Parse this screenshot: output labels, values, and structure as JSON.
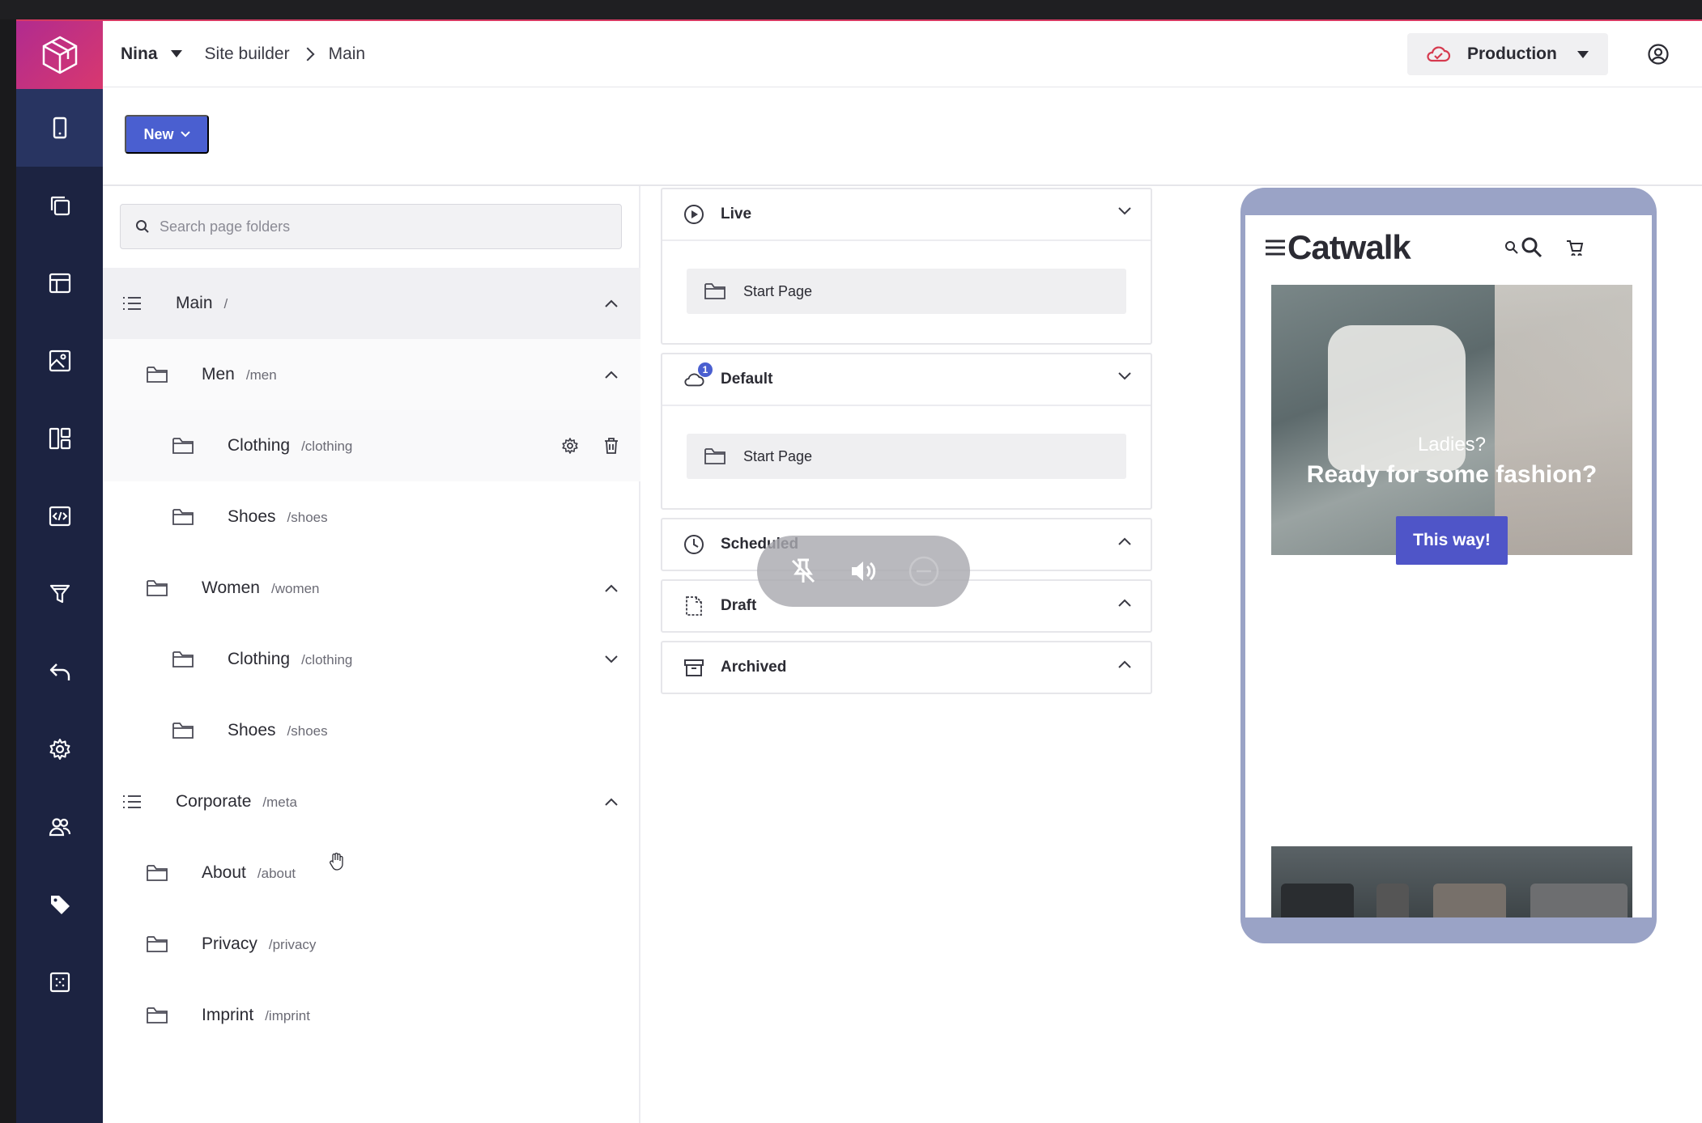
{
  "header": {
    "user": "Nina",
    "breadcrumb": [
      "Site builder",
      "Main"
    ],
    "environment": "Production"
  },
  "toolbar": {
    "new_label": "New"
  },
  "search": {
    "placeholder": "Search page folders"
  },
  "tree": [
    {
      "name": "Main",
      "path": "/"
    },
    {
      "name": "Men",
      "path": "/men"
    },
    {
      "name": "Clothing",
      "path": "/clothing"
    },
    {
      "name": "Shoes",
      "path": "/shoes"
    },
    {
      "name": "Women",
      "path": "/women"
    },
    {
      "name": "Clothing",
      "path": "/clothing"
    },
    {
      "name": "Shoes",
      "path": "/shoes"
    },
    {
      "name": "Corporate",
      "path": "/meta"
    },
    {
      "name": "About",
      "path": "/about"
    },
    {
      "name": "Privacy",
      "path": "/privacy"
    },
    {
      "name": "Imprint",
      "path": "/imprint"
    }
  ],
  "status": {
    "live": {
      "label": "Live",
      "page": "Start Page"
    },
    "default": {
      "label": "Default",
      "badge": "1",
      "page": "Start Page"
    },
    "scheduled": {
      "label": "Scheduled"
    },
    "draft": {
      "label": "Draft"
    },
    "archived": {
      "label": "Archived"
    }
  },
  "preview": {
    "brand": "Catwalk",
    "hero_line1": "Ladies?",
    "hero_line2": "Ready for some fashion?",
    "cta": "This way!"
  },
  "colors": {
    "rail": "#1c2341",
    "accent": "#4a5fd0",
    "logo": "#c8307e"
  }
}
